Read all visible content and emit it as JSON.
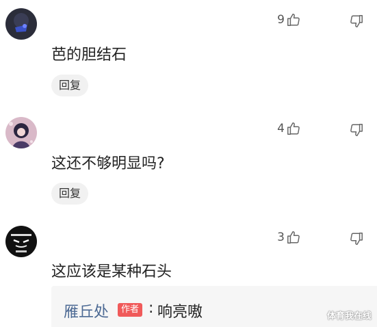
{
  "comments": [
    {
      "text": "芭的胆结石",
      "likes": "9",
      "reply_label": "回复",
      "avatar_icon": "dark-blue-avatar-icon"
    },
    {
      "text": "这还不够明显吗?",
      "likes": "4",
      "reply_label": "回复",
      "avatar_icon": "anime-girl-avatar-icon"
    },
    {
      "text": "这应该是某种石头",
      "likes": "3",
      "avatar_icon": "black-cartoon-avatar-icon"
    }
  ],
  "reply_preview": {
    "author": "雁丘处",
    "badge": "作者",
    "separator": ":",
    "text": "响亮嗷"
  },
  "watermark": "体育我在线",
  "colors": {
    "author_name": "#4d6a94",
    "author_badge": "#f05a5a",
    "reply_button_bg": "#f1f1f1",
    "icon_gray": "#666666"
  }
}
